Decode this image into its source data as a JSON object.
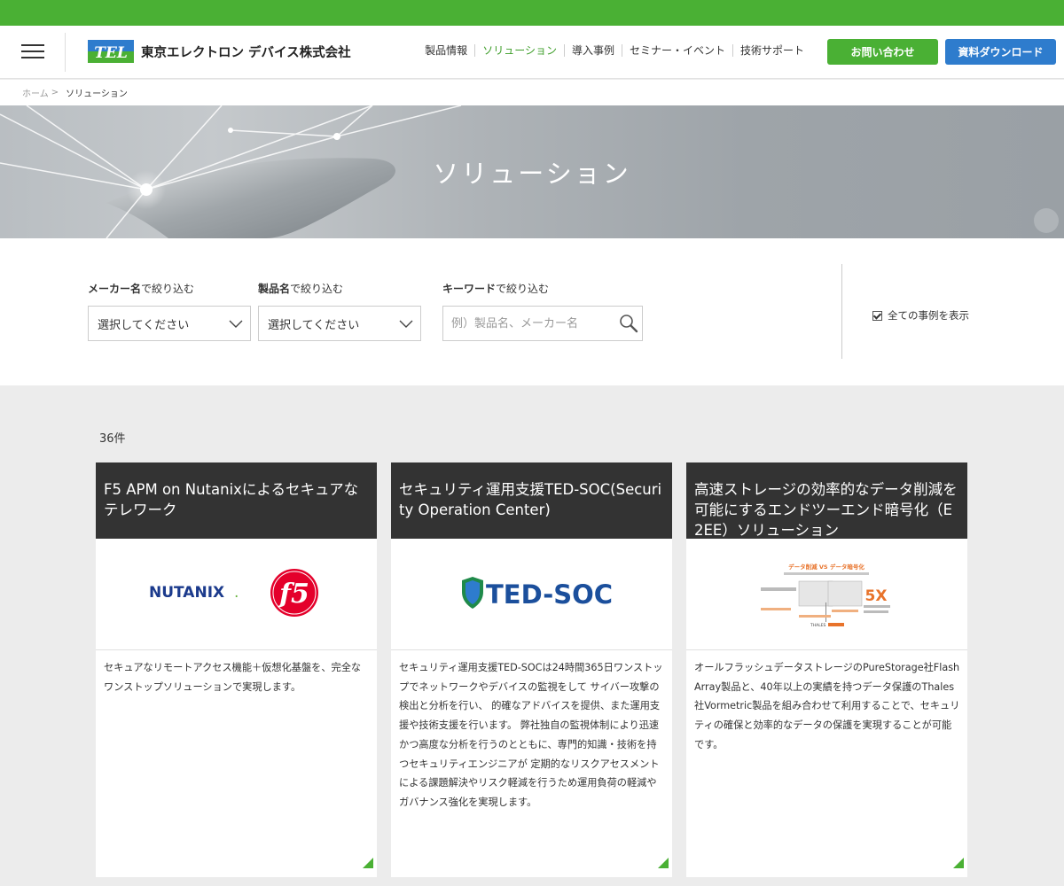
{
  "colors": {
    "brand_green": "#4ab034",
    "brand_blue": "#2e7ccd",
    "card_header": "#333333"
  },
  "header": {
    "logo_text": "東京エレクトロン デバイス株式会社",
    "logo_mark": "TEL",
    "nav": [
      "製品情報",
      "ソリューション",
      "導入事例",
      "セミナー・イベント",
      "技術サポート"
    ],
    "nav_active": "ソリューション",
    "contact_label": "お問い合わせ",
    "download_label": "資料ダウンロード"
  },
  "breadcrumb": {
    "home": "ホーム",
    "separator": ">",
    "current": "ソリューション"
  },
  "hero": {
    "title": "ソリューション"
  },
  "filters": {
    "maker": {
      "label_strong": "メーカー名",
      "label_rest": "で絞り込む",
      "value": "選択してください"
    },
    "product": {
      "label_strong": "製品名",
      "label_rest": "で絞り込む",
      "value": "選択してください"
    },
    "keyword": {
      "label_strong": "キーワード",
      "label_rest": "で絞り込む",
      "placeholder": "例）製品名、メーカー名",
      "value": ""
    },
    "show_all_label": "全ての事例を表示",
    "show_all_checked": true
  },
  "results": {
    "count": "36件"
  },
  "cards": [
    {
      "title": "F5 APM on Nutanixによるセキュアなテレワーク",
      "logo_a": "NUTANIX",
      "logo_a_suffix": ".",
      "logo_b": "f5",
      "description": "セキュアなリモートアクセス機能＋仮想化基盤を、完全なワンストップソリューションで実現します。"
    },
    {
      "title": "セキュリティ運用支援TED-SOC(Security Operation Center)",
      "logo_a": "TED-SOC",
      "description": "セキュリティ運用支援TED-SOCは24時間365日ワンストップでネットワークやデバイスの監視をして サイバー攻撃の検出と分析を行い、 的確なアドバイスを提供、また運用支援や技術支援を行います。 弊社独自の監視体制により迅速かつ高度な分析を行うのとともに、専門的知識・技術を持つセキュリティエンジニアが 定期的なリスクアセスメントによる課題解決やリスク軽減を行うため運用負荷の軽減やガバナンス強化を実現します。"
    },
    {
      "title": "高速ストレージの効率的なデータ削減を可能にするエンドツーエンド暗号化（E2EE）ソリューション",
      "logo_a": "データ削減 VS データ暗号化",
      "logo_b": "5X",
      "logo_c": "THALES",
      "description": "オールフラッシュデータストレージのPureStorage社FlashArray製品と、40年以上の実績を持つデータ保護のThales社Vormetric製品を組み合わせて利用することで、セキュリティの確保と効率的なデータの保護を実現することが可能です。"
    }
  ]
}
